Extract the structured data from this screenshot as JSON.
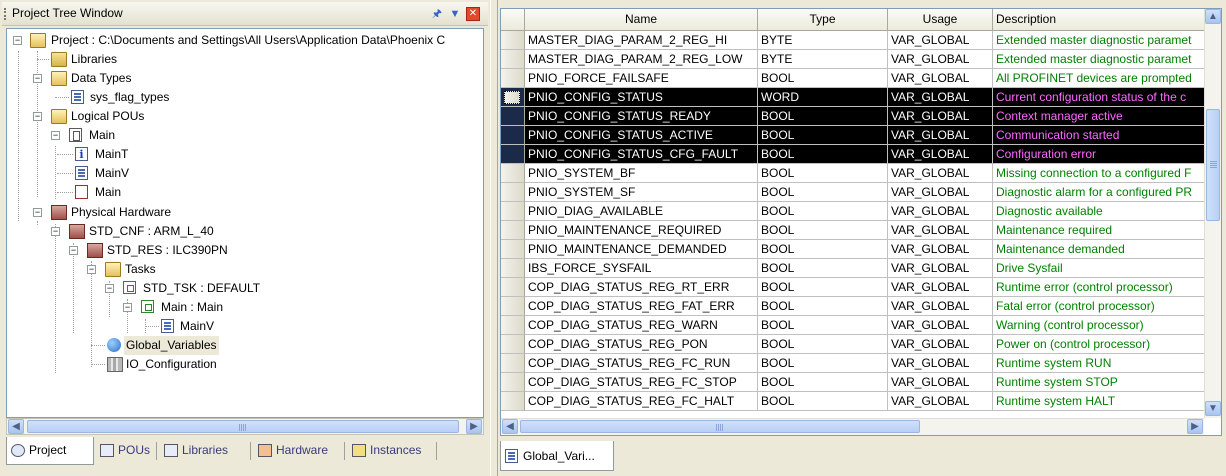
{
  "tree_window": {
    "title": "Project Tree Window",
    "nodes": [
      {
        "label": "Project : C:\\Documents and Settings\\All Users\\Application Data\\Phoenix C",
        "icon": "folder-open-icon"
      },
      {
        "label": "Libraries",
        "icon": "folder-icon"
      },
      {
        "label": "Data Types",
        "icon": "folder-open-icon"
      },
      {
        "label": "sys_flag_types",
        "icon": "datatype-doc-icon"
      },
      {
        "label": "Logical POUs",
        "icon": "folder-open-icon"
      },
      {
        "label": "Main",
        "icon": "pou-module-icon"
      },
      {
        "label": "MainT",
        "icon": "info-doc-icon"
      },
      {
        "label": "MainV",
        "icon": "variables-doc-icon"
      },
      {
        "label": "Main",
        "icon": "code-doc-icon"
      },
      {
        "label": "Physical Hardware",
        "icon": "hardware-folder-icon"
      },
      {
        "label": "STD_CNF : ARM_L_40",
        "icon": "hardware-folder-icon"
      },
      {
        "label": "STD_RES : ILC390PN",
        "icon": "hardware-folder-icon"
      },
      {
        "label": "Tasks",
        "icon": "folder-open-icon"
      },
      {
        "label": "STD_TSK : DEFAULT",
        "icon": "task-icon"
      },
      {
        "label": "Main : Main",
        "icon": "task-icon"
      },
      {
        "label": "MainV",
        "icon": "variables-doc-icon"
      },
      {
        "label": "Global_Variables",
        "icon": "globe-icon"
      },
      {
        "label": "IO_Configuration",
        "icon": "io-icon"
      }
    ],
    "tabs": [
      "Project",
      "POUs",
      "Libraries",
      "Hardware",
      "Instances"
    ]
  },
  "grid": {
    "columns": [
      "Name",
      "Type",
      "Usage",
      "Description"
    ],
    "rows": [
      {
        "name": "MASTER_DIAG_PARAM_2_REG_HI",
        "type": "BYTE",
        "usage": "VAR_GLOBAL",
        "description": "Extended master diagnostic paramet",
        "selected": false
      },
      {
        "name": "MASTER_DIAG_PARAM_2_REG_LOW",
        "type": "BYTE",
        "usage": "VAR_GLOBAL",
        "description": "Extended master diagnostic paramet",
        "selected": false
      },
      {
        "name": "PNIO_FORCE_FAILSAFE",
        "type": "BOOL",
        "usage": "VAR_GLOBAL",
        "description": "All PROFINET devices are prompted",
        "selected": false
      },
      {
        "name": "PNIO_CONFIG_STATUS",
        "type": "WORD",
        "usage": "VAR_GLOBAL",
        "description": "Current configuration status of the c",
        "selected": true
      },
      {
        "name": "PNIO_CONFIG_STATUS_READY",
        "type": "BOOL",
        "usage": "VAR_GLOBAL",
        "description": "Context manager active",
        "selected": true
      },
      {
        "name": "PNIO_CONFIG_STATUS_ACTIVE",
        "type": "BOOL",
        "usage": "VAR_GLOBAL",
        "description": "Communication started",
        "selected": true
      },
      {
        "name": "PNIO_CONFIG_STATUS_CFG_FAULT",
        "type": "BOOL",
        "usage": "VAR_GLOBAL",
        "description": "Configuration error",
        "selected": true
      },
      {
        "name": "PNIO_SYSTEM_BF",
        "type": "BOOL",
        "usage": "VAR_GLOBAL",
        "description": "Missing connection to a configured F",
        "selected": false
      },
      {
        "name": "PNIO_SYSTEM_SF",
        "type": "BOOL",
        "usage": "VAR_GLOBAL",
        "description": "Diagnostic alarm for a configured PR",
        "selected": false
      },
      {
        "name": "PNIO_DIAG_AVAILABLE",
        "type": "BOOL",
        "usage": "VAR_GLOBAL",
        "description": "Diagnostic available",
        "selected": false
      },
      {
        "name": "PNIO_MAINTENANCE_REQUIRED",
        "type": "BOOL",
        "usage": "VAR_GLOBAL",
        "description": "Maintenance required",
        "selected": false
      },
      {
        "name": "PNIO_MAINTENANCE_DEMANDED",
        "type": "BOOL",
        "usage": "VAR_GLOBAL",
        "description": "Maintenance demanded",
        "selected": false
      },
      {
        "name": "IBS_FORCE_SYSFAIL",
        "type": "BOOL",
        "usage": "VAR_GLOBAL",
        "description": "Drive Sysfail",
        "selected": false
      },
      {
        "name": "COP_DIAG_STATUS_REG_RT_ERR",
        "type": "BOOL",
        "usage": "VAR_GLOBAL",
        "description": "Runtime error (control processor)",
        "selected": false
      },
      {
        "name": "COP_DIAG_STATUS_REG_FAT_ERR",
        "type": "BOOL",
        "usage": "VAR_GLOBAL",
        "description": "Fatal error (control processor)",
        "selected": false
      },
      {
        "name": "COP_DIAG_STATUS_REG_WARN",
        "type": "BOOL",
        "usage": "VAR_GLOBAL",
        "description": "Warning (control processor)",
        "selected": false
      },
      {
        "name": "COP_DIAG_STATUS_REG_PON",
        "type": "BOOL",
        "usage": "VAR_GLOBAL",
        "description": "Power on (control processor)",
        "selected": false
      },
      {
        "name": "COP_DIAG_STATUS_REG_FC_RUN",
        "type": "BOOL",
        "usage": "VAR_GLOBAL",
        "description": "Runtime system RUN",
        "selected": false
      },
      {
        "name": "COP_DIAG_STATUS_REG_FC_STOP",
        "type": "BOOL",
        "usage": "VAR_GLOBAL",
        "description": "Runtime system STOP",
        "selected": false
      },
      {
        "name": "COP_DIAG_STATUS_REG_FC_HALT",
        "type": "BOOL",
        "usage": "VAR_GLOBAL",
        "description": "Runtime system HALT",
        "selected": false
      }
    ],
    "doc_tab": "Global_Vari..."
  },
  "colors": {
    "description_text": "#008000",
    "selected_row_bg": "#000000",
    "selected_description": "#ff6aff"
  }
}
